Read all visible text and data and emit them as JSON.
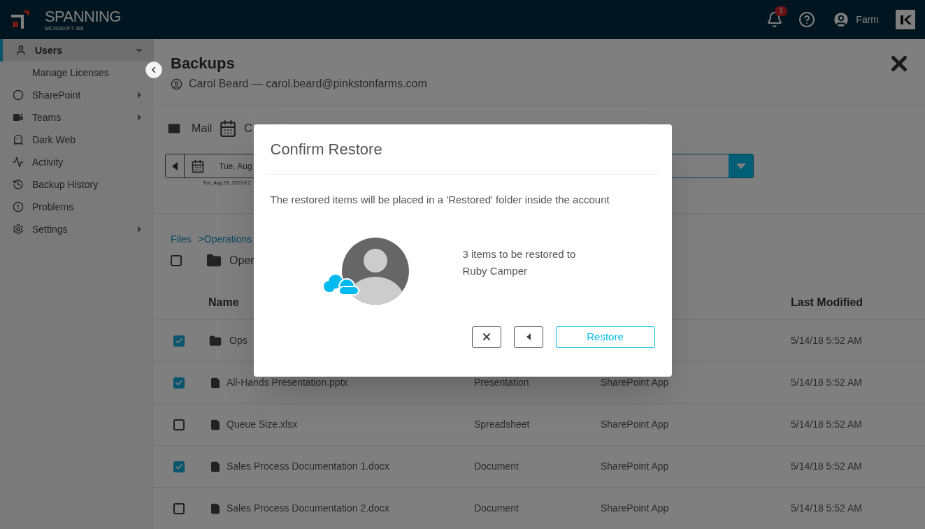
{
  "header": {
    "brand": "SPANNING",
    "subbrand": "MICROSOFT 365",
    "notification_count": "1",
    "user": "Farm"
  },
  "sidebar": {
    "items": [
      {
        "label": "Users",
        "kind": "group",
        "expanded": true,
        "selected": true
      },
      {
        "label": "Manage Licenses",
        "kind": "sub",
        "selected": false
      },
      {
        "label": "SharePoint",
        "kind": "group",
        "expanded": false,
        "selected": false
      },
      {
        "label": "Teams",
        "kind": "group",
        "expanded": false,
        "selected": false
      },
      {
        "label": "Dark Web",
        "kind": "link",
        "selected": false
      },
      {
        "label": "Activity",
        "kind": "link",
        "selected": false
      },
      {
        "label": "Backup History",
        "kind": "link",
        "selected": false
      },
      {
        "label": "Problems",
        "kind": "link",
        "selected": false
      },
      {
        "label": "Settings",
        "kind": "group",
        "expanded": false,
        "selected": false
      }
    ]
  },
  "page": {
    "title": "Backups",
    "user_line": "Carol Beard — carol.beard@pinkstonfarms.com"
  },
  "services": [
    {
      "label": "Mail"
    },
    {
      "label": "C"
    }
  ],
  "date_picker": {
    "value": "Tue, Aug",
    "caption": "Tue, Aug 29, 2023 6:2"
  },
  "breadcrumb": [
    "Files",
    ">Operations"
  ],
  "folder": {
    "name": "Oper",
    "checked": false
  },
  "table": {
    "columns": [
      {
        "label": "Name"
      },
      {
        "label": "Last Modified"
      }
    ],
    "rows": [
      {
        "kind": "folder",
        "name": "Ops",
        "checked": true,
        "modified": "5/14/18 5:52 AM"
      },
      {
        "kind": "file",
        "name": "All-Hands Presentation.pptx",
        "type": "Presentation",
        "source": "SharePoint App",
        "checked": true,
        "modified": "5/14/18 5:52 AM"
      },
      {
        "kind": "file",
        "name": "Queue Size.xlsx",
        "type": "Spreadsheet",
        "source": "SharePoint App",
        "checked": false,
        "modified": "5/14/18 5:52 AM"
      },
      {
        "kind": "file",
        "name": "Sales Process Documentation 1.docx",
        "type": "Document",
        "source": "SharePoint App",
        "checked": true,
        "modified": "5/14/18 5:52 AM"
      },
      {
        "kind": "file",
        "name": "Sales Process Documentation 2.docx",
        "type": "Document",
        "source": "SharePoint App",
        "checked": false,
        "modified": "5/14/18 5:52 AM"
      }
    ]
  },
  "dialog": {
    "title": "Confirm Restore",
    "message": "The restored items will be placed in a 'Restored' folder inside the account",
    "summary": [
      "3 items to be restored to",
      "Ruby Camper"
    ],
    "confirm": "Restore"
  }
}
